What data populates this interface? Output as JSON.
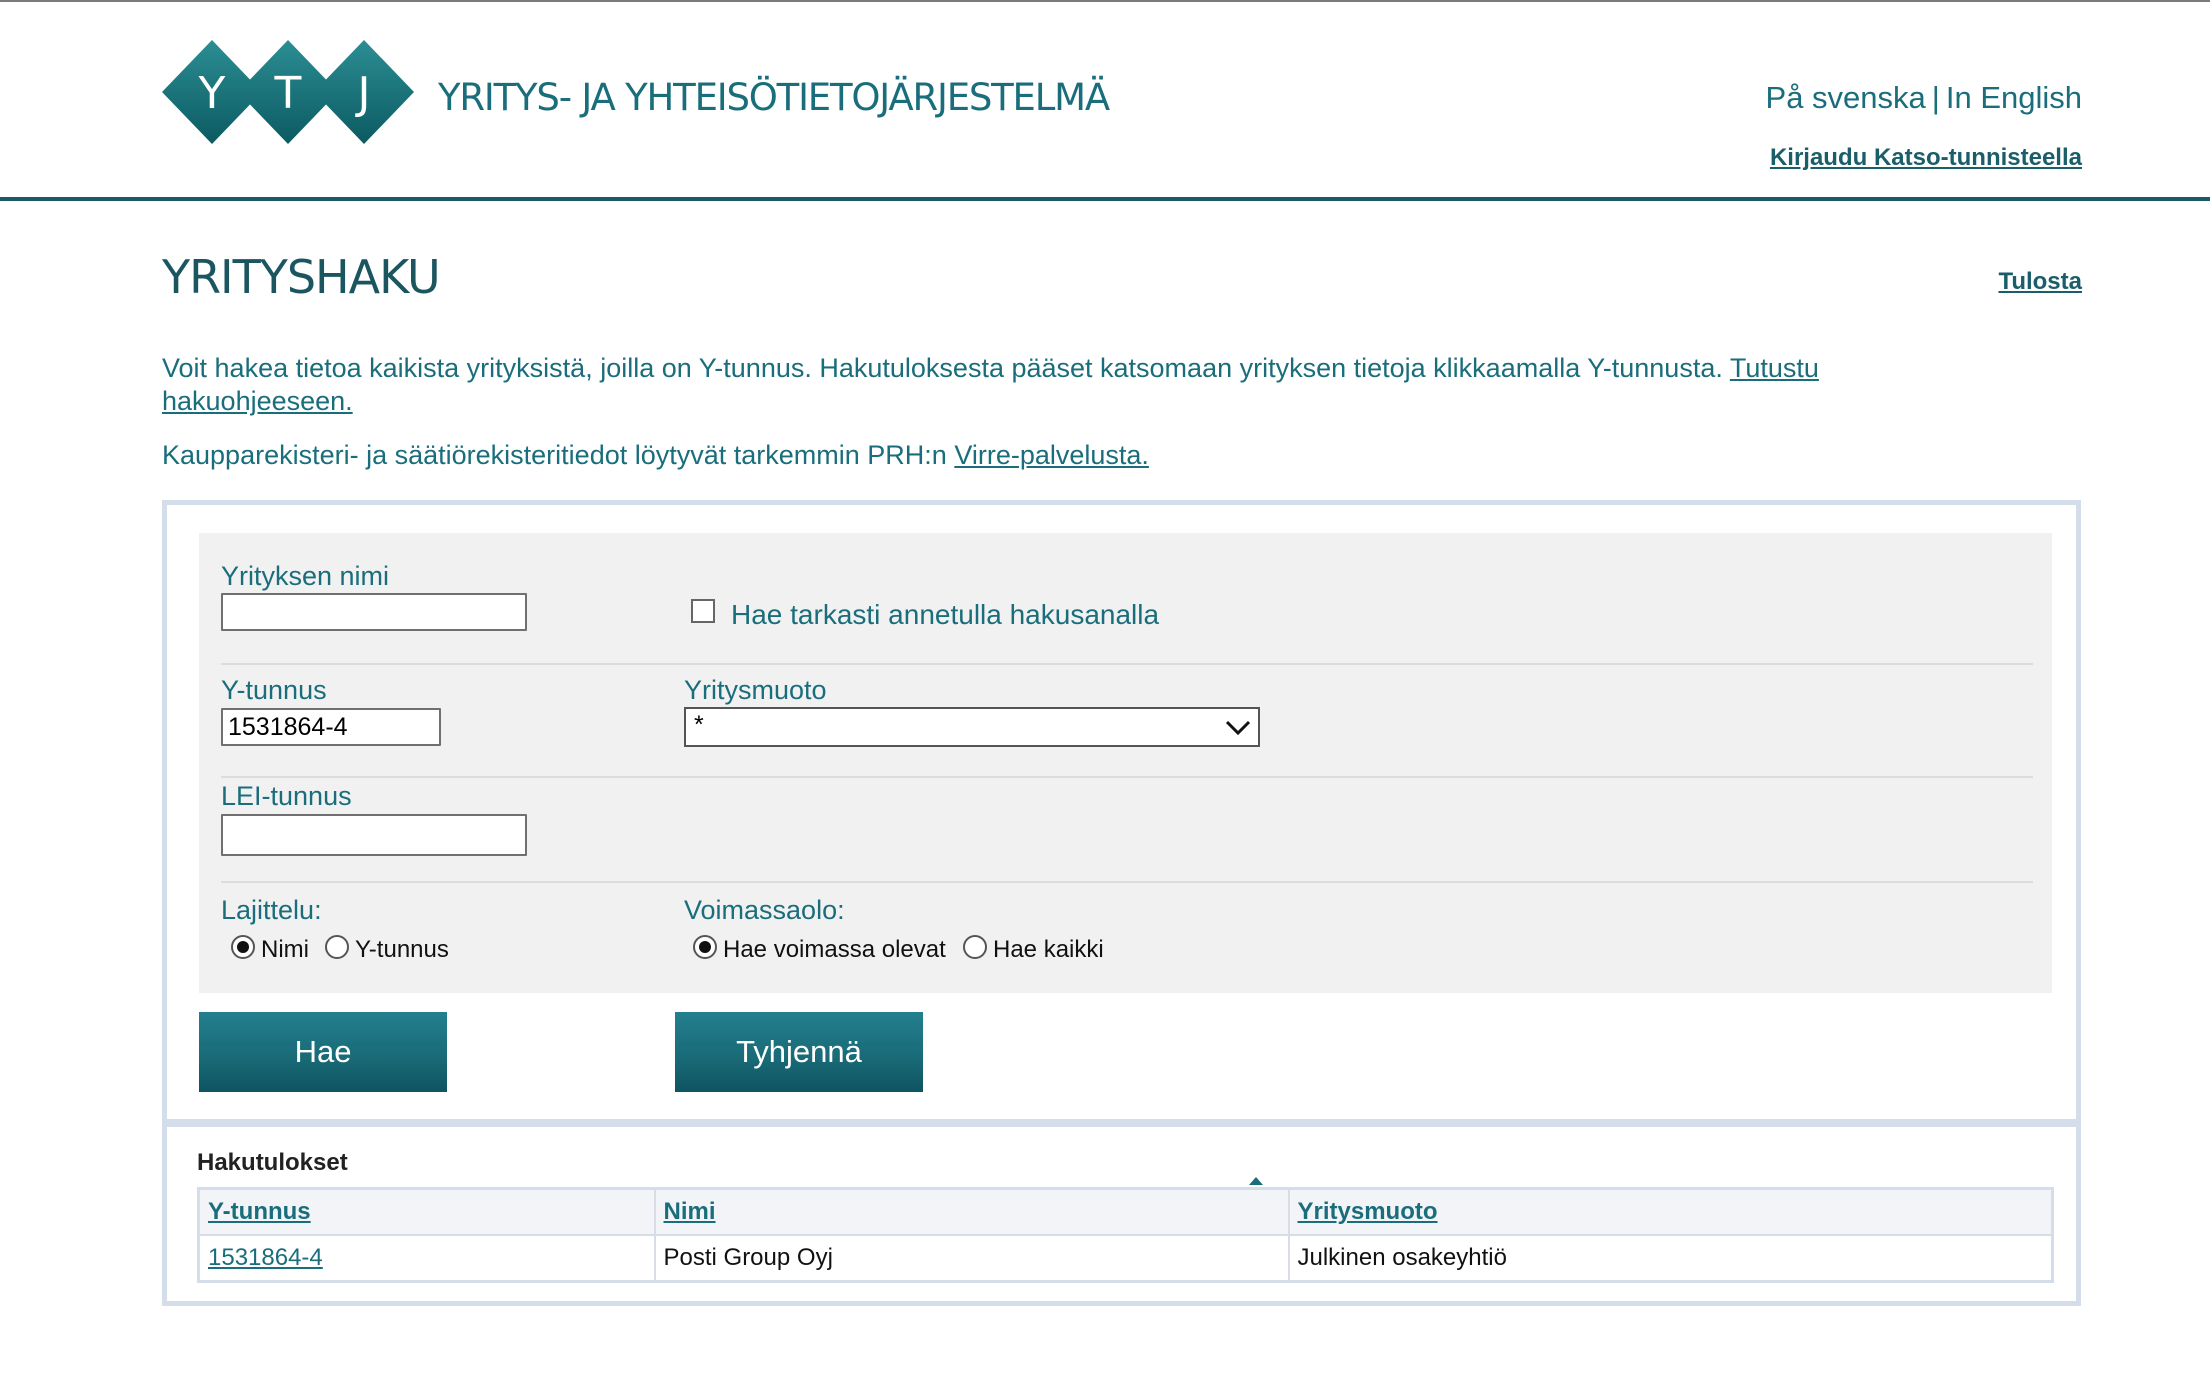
{
  "header": {
    "logo_letters": [
      "Y",
      "T",
      "J"
    ],
    "logo_text": "YRITYS- JA YHTEISÖTIETOJÄRJESTELMÄ",
    "lang_sv": "På svenska",
    "lang_sep": "|",
    "lang_en": "In English",
    "login_link": "Kirjaudu Katso-tunnisteella"
  },
  "page": {
    "title": "YRITYSHAKU",
    "print_link": "Tulosta",
    "intro_text": "Voit hakea tietoa kaikista yrityksistä, joilla on Y-tunnus. Hakutuloksesta pääset katsomaan yrityksen tietoja klikkaamalla Y-tunnusta.",
    "intro_link": "Tutustu hakuohjeeseen.",
    "intro2_text": "Kaupparekisteri- ja säätiörekisteritiedot löytyvät tarkemmin PRH:n",
    "intro2_link": "Virre-palvelusta."
  },
  "form": {
    "company_name_label": "Yrityksen nimi",
    "company_name_value": "",
    "exact_search_label": "Hae tarkasti annetulla hakusanalla",
    "exact_search_checked": false,
    "business_id_label": "Y-tunnus",
    "business_id_value": "1531864-4",
    "company_form_label": "Yritysmuoto",
    "company_form_value": "*",
    "lei_label": "LEI-tunnus",
    "lei_value": "",
    "sort_label": "Lajittelu:",
    "sort_options": [
      {
        "label": "Nimi",
        "selected": true
      },
      {
        "label": "Y-tunnus",
        "selected": false
      }
    ],
    "validity_label": "Voimassaolo:",
    "validity_options": [
      {
        "label": "Hae voimassa olevat",
        "selected": true
      },
      {
        "label": "Hae kaikki",
        "selected": false
      }
    ],
    "search_button": "Hae",
    "clear_button": "Tyhjennä"
  },
  "results": {
    "title": "Hakutulokset",
    "columns": [
      "Y-tunnus",
      "Nimi",
      "Yritysmuoto"
    ],
    "rows": [
      {
        "business_id": "1531864-4",
        "name": "Posti Group Oyj",
        "company_form": "Julkinen osakeyhtiö"
      }
    ]
  },
  "colors": {
    "brand_teal": "#1a6e7c",
    "header_rule": "#1e5a66",
    "box_border": "#d4deea",
    "form_bg": "#f1f1f1"
  }
}
